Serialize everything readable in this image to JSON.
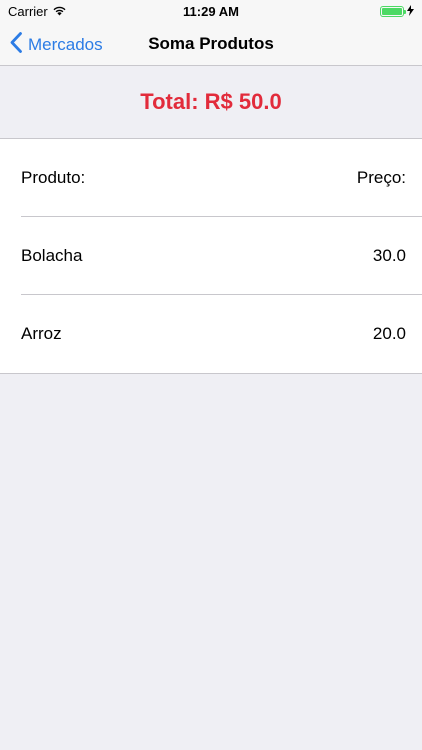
{
  "status_bar": {
    "carrier": "Carrier",
    "time": "11:29 AM",
    "battery_level": 1.0,
    "charging": true
  },
  "nav": {
    "back_label": "Mercados",
    "title": "Soma Produtos"
  },
  "total": {
    "label": "Total: R$ 50.0"
  },
  "table": {
    "header": {
      "product": "Produto:",
      "price": "Preço:"
    },
    "rows": [
      {
        "product": "Bolacha",
        "price": "30.0"
      },
      {
        "product": "Arroz",
        "price": "20.0"
      }
    ]
  },
  "colors": {
    "accent": "#2c7ce5",
    "total_red": "#e22b3b",
    "background": "#efeff4",
    "battery_green": "#4cd964"
  }
}
